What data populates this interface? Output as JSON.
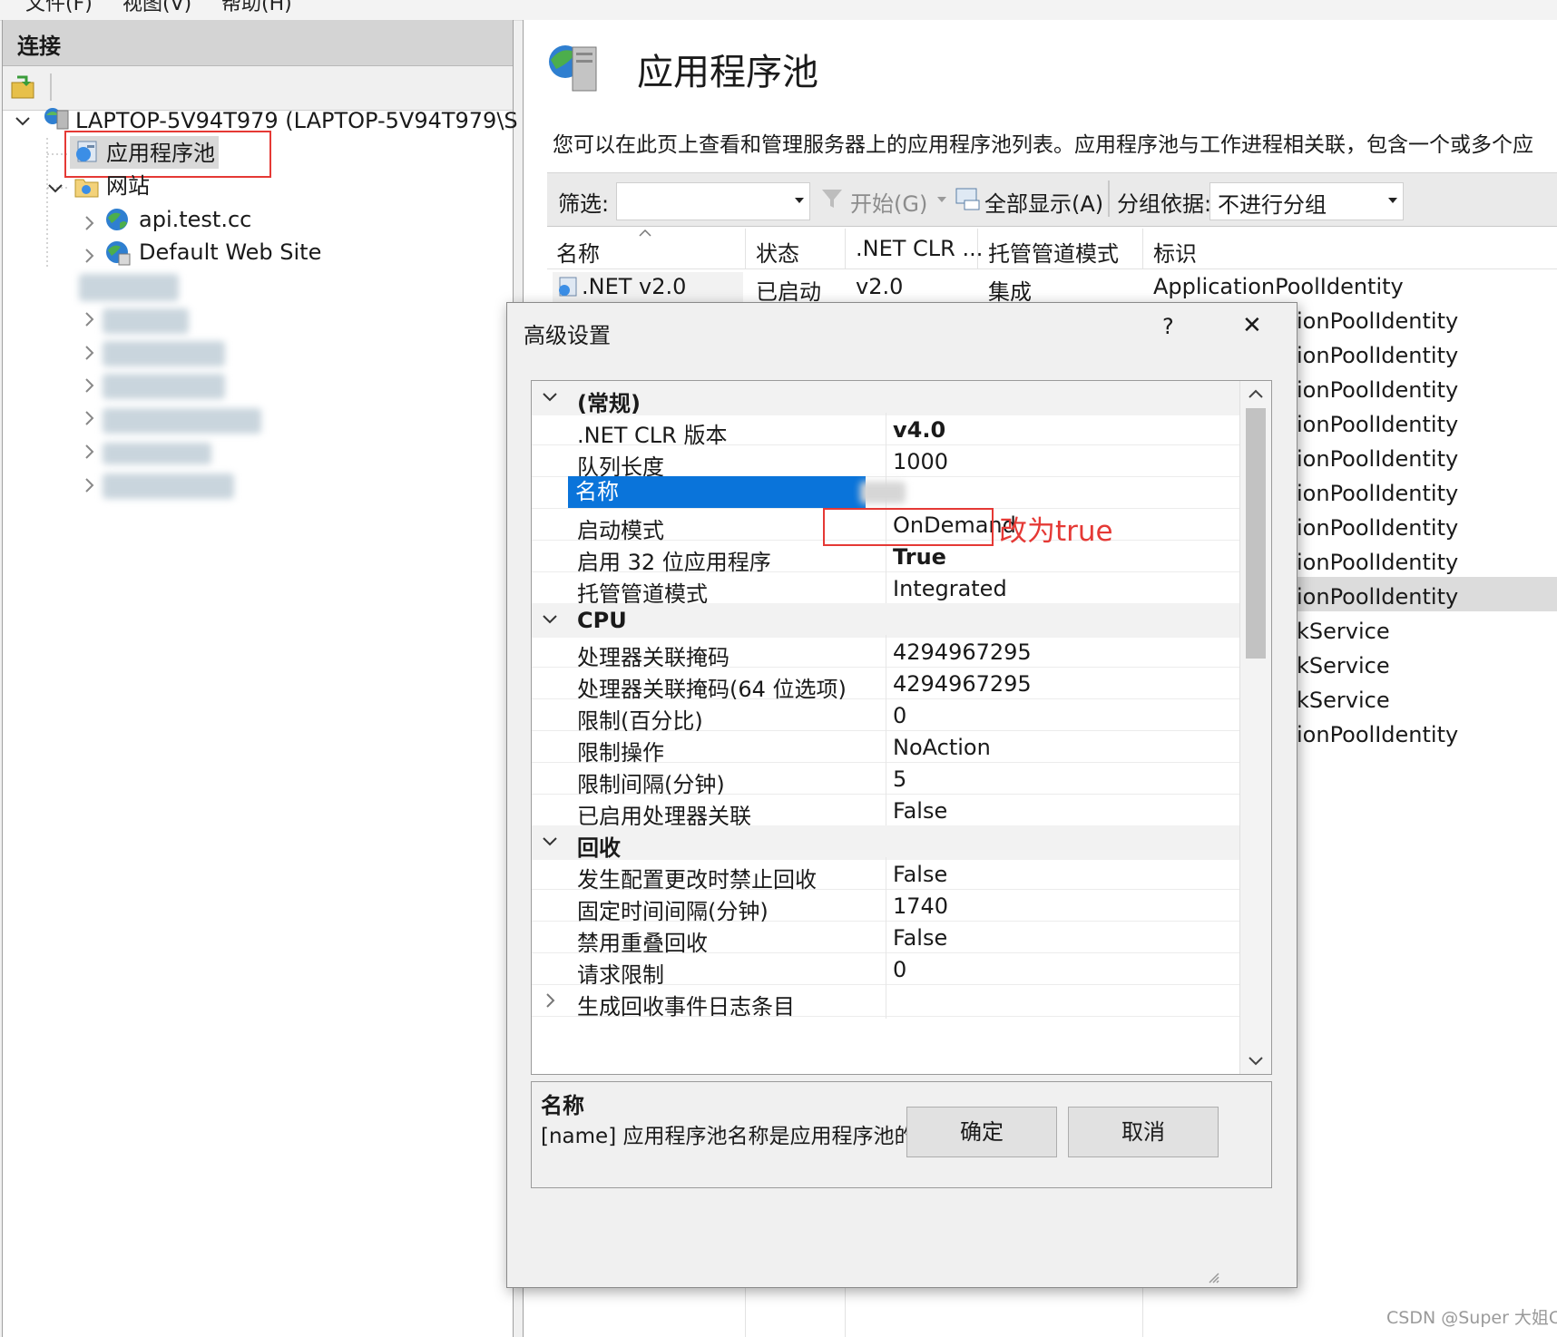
{
  "menubar": [
    "文件(F)",
    "视图(V)",
    "帮助(H)"
  ],
  "connections": {
    "title": "连接",
    "server_label": "LAPTOP-5V94T979 (LAPTOP-5V94T979\\S",
    "app_pools_label": "应用程序池",
    "sites_label": "网站",
    "sites": [
      "api.test.cc",
      "Default Web Site"
    ]
  },
  "main": {
    "title": "应用程序池",
    "description": "您可以在此页上查看和管理服务器上的应用程序池列表。应用程序池与工作进程相关联，包含一个或多个应",
    "filter_label": "筛选:",
    "start_label": "开始(G)",
    "show_all_label": "全部显示(A)",
    "group_by_label": "分组依据:",
    "group_by_value": "不进行分组",
    "columns": [
      "名称",
      "状态",
      ".NET CLR ...",
      "托管管道模式",
      "标识"
    ],
    "first_row": {
      "name": ".NET v2.0",
      "status": "已启动",
      "clr": "v2.0",
      "pipeline": "集成",
      "identity": "ApplicationPoolIdentity"
    },
    "identity_partials": [
      "ionPoolIdentity",
      "ionPoolIdentity",
      "ionPoolIdentity",
      "ionPoolIdentity",
      "ionPoolIdentity",
      "ionPoolIdentity",
      "ionPoolIdentity",
      "ionPoolIdentity",
      "ionPoolIdentity",
      "kService",
      "kService",
      "kService",
      "ionPoolIdentity"
    ]
  },
  "dialog": {
    "title": "高级设置",
    "help_glyph": "?",
    "close_glyph": "✕",
    "rows": [
      {
        "type": "cat",
        "key": "(常规)",
        "expanded": true
      },
      {
        "key": ".NET CLR 版本",
        "value": "v4.0",
        "bold": true
      },
      {
        "key": "队列长度",
        "value": "1000"
      },
      {
        "key": "名称",
        "value": "",
        "selected": true
      },
      {
        "key": "启动模式",
        "value": "OnDemand"
      },
      {
        "key": "启用 32 位应用程序",
        "value": "True",
        "bold": true
      },
      {
        "key": "托管管道模式",
        "value": "Integrated"
      },
      {
        "type": "cat",
        "key": "CPU",
        "expanded": true
      },
      {
        "key": "处理器关联掩码",
        "value": "4294967295"
      },
      {
        "key": "处理器关联掩码(64 位选项)",
        "value": "4294967295"
      },
      {
        "key": "限制(百分比)",
        "value": "0"
      },
      {
        "key": "限制操作",
        "value": "NoAction"
      },
      {
        "key": "限制间隔(分钟)",
        "value": "5"
      },
      {
        "key": "已启用处理器关联",
        "value": "False"
      },
      {
        "type": "cat",
        "key": "回收",
        "expanded": true
      },
      {
        "key": "发生配置更改时禁止回收",
        "value": "False"
      },
      {
        "key": "固定时间间隔(分钟)",
        "value": "1740"
      },
      {
        "key": "禁用重叠回收",
        "value": "False"
      },
      {
        "key": "请求限制",
        "value": "0"
      },
      {
        "key": "生成回收事件日志条目",
        "value": "",
        "collapsed_child": true
      }
    ],
    "desc_title": "名称",
    "desc_text": "[name] 应用程序池名称是应用程序池的唯一标识符。",
    "ok_label": "确定",
    "cancel_label": "取消"
  },
  "annotation": {
    "text": "改为true",
    "color": "#e53935"
  },
  "watermark": "CSDN @Super 大姐C",
  "colors": {
    "selection": "#0a74da",
    "highlight_box": "#e53935"
  }
}
